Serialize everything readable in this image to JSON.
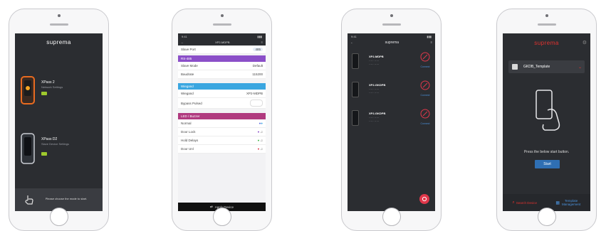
{
  "brand": "suprema",
  "phone1": {
    "device1_name": "XPass 2",
    "device1_sub": "Network Settings",
    "device2_name": "XPass D2",
    "device2_sub": "Slave Device Settings",
    "footer_text": "Please choose the mode to start.",
    "accent": "#e96b20"
  },
  "phone2": {
    "title": "XP2-MDPB",
    "header_row_label": "Slave Port",
    "header_row_value": "485",
    "section1": "RS-485",
    "rows1": [
      {
        "label": "Slave Mode",
        "value": "Default"
      },
      {
        "label": "Baudrate",
        "value": "115200"
      }
    ],
    "section2": "Wiegand",
    "rows2": [
      {
        "label": "Wiegand",
        "value": "XP2-MDPB"
      },
      {
        "label": "Bypass Pulsed",
        "value": ""
      }
    ],
    "section3": "LED / Buzzer",
    "rows3": [
      {
        "label": "Normal"
      },
      {
        "label": "Door Lock"
      },
      {
        "label": "Hold Delays"
      },
      {
        "label": "Door Unl"
      }
    ],
    "apply_label": "Apply Device",
    "colors": {
      "purple": "#8b4fc8",
      "blue": "#3aa6e0",
      "magenta": "#b03a7f"
    }
  },
  "phone3": {
    "devices": [
      {
        "name": "XP2-MDPB",
        "action": "Connect"
      },
      {
        "name": "XP2-GKDPB",
        "action": "Connect"
      },
      {
        "name": "XP2-GKDPB",
        "action": "Connect"
      }
    ],
    "accent": "#e0374a"
  },
  "phone4": {
    "template_name": "GKDB_Template",
    "prompt": "Press the below start button.",
    "start_label": "Start",
    "search_label": "Search Device",
    "template_label": "Template Management",
    "accent": "#e5322f",
    "button_color": "#2f6fb3"
  }
}
